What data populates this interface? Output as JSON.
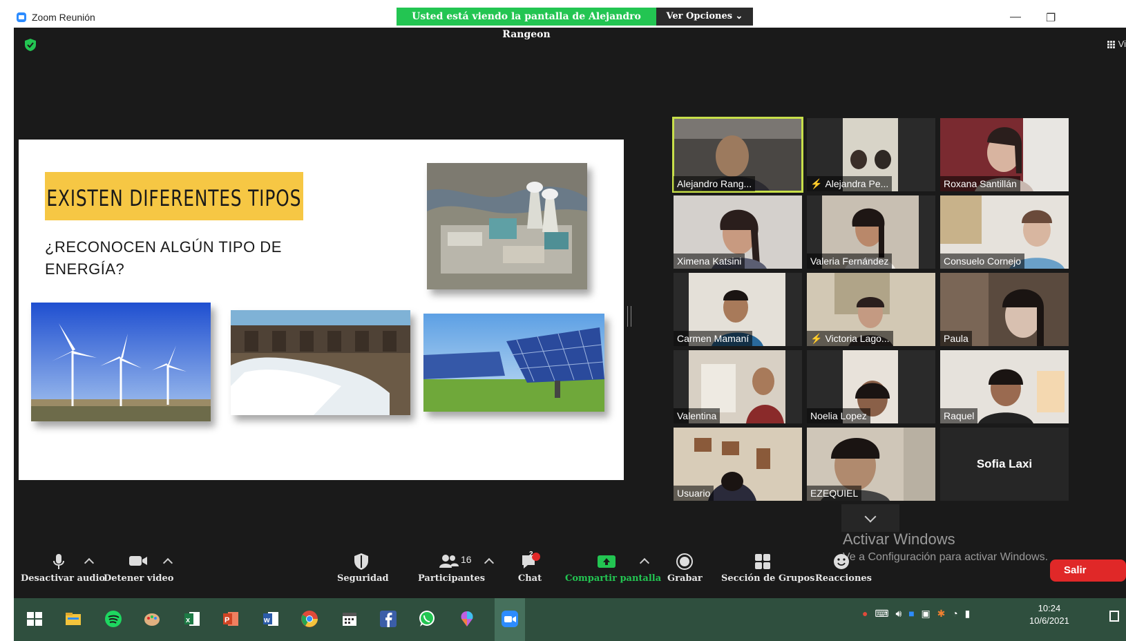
{
  "window": {
    "title": "Zoom Reunión",
    "share_banner": "Usted está viendo la pantalla de Alejandro Rangeon",
    "view_options": "Ver Opciones ⌄",
    "gallery_view_label": "Vi",
    "minimize": "—",
    "restore": "❐"
  },
  "slide": {
    "title": "EXISTEN DIFERENTES TIPOS",
    "question": "¿RECONOCEN ALGÚN TIPO DE ENERGÍA?",
    "title_bg": "#f6c744"
  },
  "participants": [
    {
      "name": "Alejandro Rang...",
      "muted": false,
      "active": true
    },
    {
      "name": "Alejandra Pe...",
      "muted": true,
      "active": false
    },
    {
      "name": "Roxana Santillán",
      "muted": false,
      "active": false
    },
    {
      "name": "Ximena Katsini",
      "muted": false,
      "active": false
    },
    {
      "name": "Valeria Fernández",
      "muted": false,
      "active": false
    },
    {
      "name": "Consuelo Cornejo",
      "muted": false,
      "active": false
    },
    {
      "name": "Carmen Mamaní",
      "muted": false,
      "active": false
    },
    {
      "name": "Victoria Lago...",
      "muted": true,
      "active": false
    },
    {
      "name": "Paula",
      "muted": false,
      "active": false
    },
    {
      "name": "Valentina",
      "muted": false,
      "active": false
    },
    {
      "name": "Noelia Lopez",
      "muted": false,
      "active": false
    },
    {
      "name": "Raquel",
      "muted": false,
      "active": false
    },
    {
      "name": "Usuario",
      "muted": false,
      "active": false
    },
    {
      "name": "EZEQUIEL",
      "muted": false,
      "active": false
    },
    {
      "name": "Sofia Laxi",
      "muted": false,
      "active": false,
      "video_off": true
    }
  ],
  "watermark": {
    "line1": "Activar Windows",
    "line2": "Ve a Configuración para activar Windows."
  },
  "toolbar": {
    "audio": "Desactivar audio",
    "video": "Detener video",
    "security": "Seguridad",
    "participants": "Participantes",
    "participants_count": "16",
    "chat": "Chat",
    "chat_badge": "2",
    "share": "Compartir pantalla",
    "record": "Grabar",
    "breakout": "Sección de Grupos",
    "reactions": "Reacciones",
    "leave": "Salir",
    "share_color": "#23c552",
    "leave_color": "#e02828"
  },
  "taskbar": {
    "time": "10:24",
    "date": "10/6/2021",
    "apps": [
      "windows-start",
      "file-explorer",
      "spotify",
      "paint",
      "excel",
      "powerpoint",
      "word",
      "chrome",
      "calendar",
      "facebook",
      "whatsapp",
      "paint-3d",
      "zoom"
    ]
  }
}
